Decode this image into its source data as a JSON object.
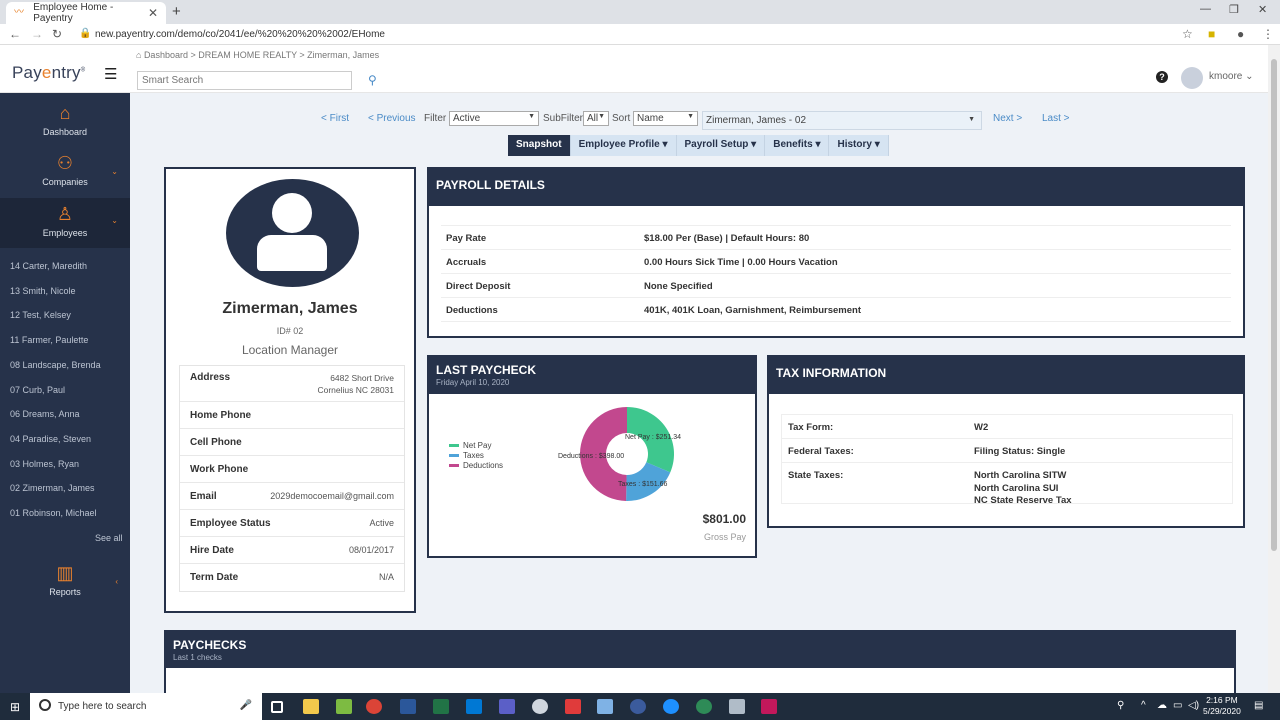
{
  "browser": {
    "tab_title": "Employee Home - Payentry",
    "url": "new.payentry.com/demo/co/2041/ee/%20%20%20%2002/EHome"
  },
  "header": {
    "logo_pre": "Pay",
    "logo_a": "e",
    "logo_post": "ntry",
    "logo_tm": "®",
    "breadcrumb": "Dashboard > DREAM HOME REALTY > Zimerman, James",
    "search_placeholder": "Smart Search",
    "username": "kmoore"
  },
  "sidebar": {
    "nav": [
      {
        "label": "Dashboard"
      },
      {
        "label": "Companies"
      },
      {
        "label": "Employees"
      }
    ],
    "employees": [
      "14 Carter, Maredith",
      "13 Smith, Nicole",
      "12 Test, Kelsey",
      "11 Farmer, Paulette",
      "08 Landscape, Brenda",
      "07 Curb, Paul",
      "06 Dreams, Anna",
      "04 Paradise, Steven",
      "03 Holmes, Ryan",
      "02 Zimerman, James",
      "01 Robinson, Michael"
    ],
    "see_all": "See all",
    "reports": "Reports"
  },
  "filters": {
    "first": "< First",
    "previous": "< Previous",
    "filter_label": "Filter",
    "filter_value": "Active",
    "subfilter_label": "SubFilter",
    "subfilter_value": "All",
    "sort_label": "Sort",
    "sort_value": "Name",
    "employee_value": "Zimerman, James - 02",
    "next": "Next >",
    "last": "Last >"
  },
  "tabs": [
    "Snapshot",
    "Employee Profile ▾",
    "Payroll Setup ▾",
    "Benefits ▾",
    "History ▾"
  ],
  "profile": {
    "name": "Zimerman, James",
    "id": "ID# 02",
    "role": "Location Manager",
    "address_label": "Address",
    "address_line1": "6482 Short Drive",
    "address_line2": "Cornelius NC 28031",
    "home_phone_label": "Home Phone",
    "cell_phone_label": "Cell Phone",
    "work_phone_label": "Work Phone",
    "email_label": "Email",
    "email": "2029democoemail@gmail.com",
    "status_label": "Employee Status",
    "status": "Active",
    "hire_label": "Hire Date",
    "hire_date": "08/01/2017",
    "term_label": "Term Date",
    "term_date": "N/A"
  },
  "payroll": {
    "title": "PAYROLL DETAILS",
    "rows": [
      {
        "k": "Pay Rate",
        "v": "$18.00 Per (Base) | Default Hours: 80"
      },
      {
        "k": "Accruals",
        "v": "0.00 Hours Sick Time | 0.00 Hours Vacation"
      },
      {
        "k": "Direct Deposit",
        "v": "None Specified"
      },
      {
        "k": "Deductions",
        "v": "401K, 401K Loan, Garnishment, Reimbursement"
      }
    ]
  },
  "last_paycheck": {
    "title": "LAST PAYCHECK",
    "date": "Friday April 10, 2020",
    "gross": "$801.00",
    "gross_label": "Gross Pay",
    "legend_net": "Net Pay",
    "legend_taxes": "Taxes",
    "legend_deductions": "Deductions",
    "label_net": "Net Pay : $251.34",
    "label_taxes": "Taxes : $151.66",
    "label_deductions": "Deductions : $398.00"
  },
  "chart_data": {
    "type": "pie",
    "categories": [
      "Net Pay",
      "Taxes",
      "Deductions"
    ],
    "values": [
      251.34,
      151.66,
      398.0
    ],
    "colors": [
      "#3ec78e",
      "#4fa3d9",
      "#c2488e"
    ]
  },
  "tax": {
    "title": "TAX INFORMATION",
    "tax_form_label": "Tax Form:",
    "tax_form": "W2",
    "federal_label": "Federal Taxes:",
    "federal": "Filing Status: Single",
    "state_label": "State Taxes:",
    "state_1": "North Carolina SITW",
    "state_2": "North Carolina SUI",
    "state_3": "NC State Reserve Tax"
  },
  "paychecks": {
    "title": "PAYCHECKS",
    "subtitle": "Last 1 checks"
  },
  "taskbar": {
    "search_placeholder": "Type here to search",
    "time": "2:16 PM",
    "date": "5/29/2020"
  },
  "colors": {
    "navy": "#26324a",
    "accent": "#e8812e",
    "link": "#4a8bc7"
  }
}
